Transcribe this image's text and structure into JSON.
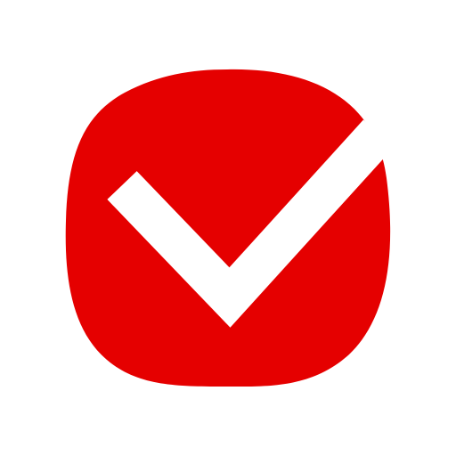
{
  "icon": {
    "name": "checkmark-app-icon",
    "shape": "squircle",
    "glyph": "check-mark-icon"
  },
  "colors": {
    "background": "#ffffff",
    "badge": "#e50000",
    "check": "#ffffff"
  }
}
